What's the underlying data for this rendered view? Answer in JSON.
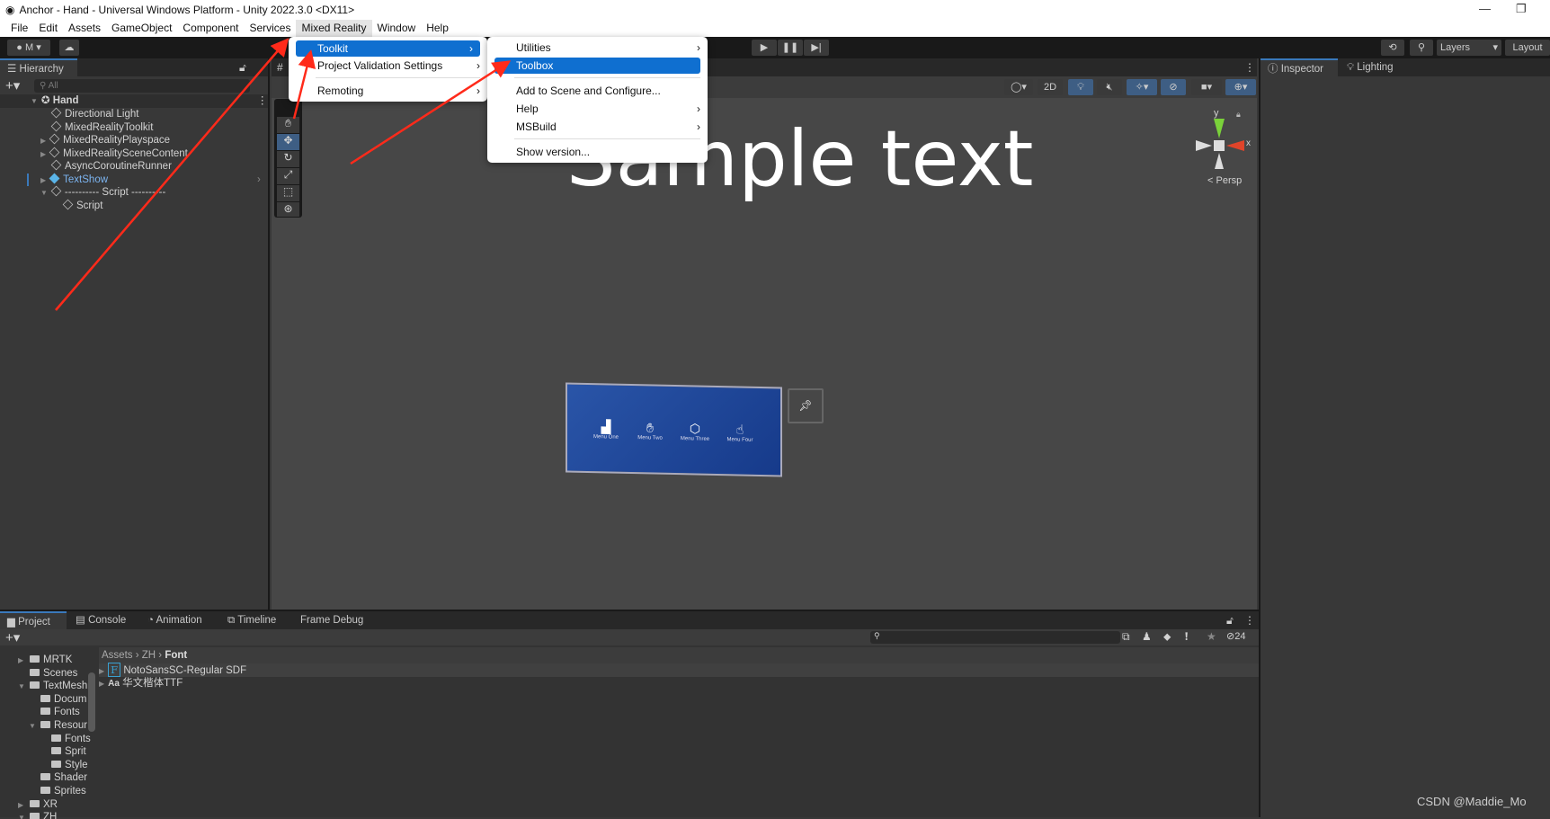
{
  "window": {
    "title": "Anchor - Hand - Universal Windows Platform - Unity 2022.3.0 <DX11>",
    "minimize_icon": "minimize-icon",
    "maximize_icon": "maximize-icon"
  },
  "menubar": [
    "File",
    "Edit",
    "Assets",
    "GameObject",
    "Component",
    "Services",
    "Mixed Reality",
    "Window",
    "Help"
  ],
  "toolbar": {
    "account": "M",
    "layers": "Layers",
    "layout": "Layout"
  },
  "mixed_reality_menu": {
    "items": [
      {
        "label": "Toolkit",
        "selected": true,
        "submenu": true
      },
      {
        "label": "Project Validation Settings",
        "submenu": true
      },
      {
        "label": "Remoting",
        "submenu": true
      }
    ]
  },
  "toolkit_submenu": {
    "items": [
      {
        "label": "Utilities",
        "submenu": true
      },
      {
        "label": "Toolbox",
        "selected": true
      },
      {
        "label": "Add to Scene and Configure..."
      },
      {
        "label": "Help",
        "submenu": true
      },
      {
        "label": "MSBuild",
        "submenu": true
      },
      {
        "label": "Show version..."
      }
    ]
  },
  "hierarchy": {
    "tab": "Hierarchy",
    "search_placeholder": "All",
    "root": "Hand",
    "items": [
      "Directional Light",
      "MixedRealityToolkit",
      "MixedRealityPlayspace",
      "MixedRealitySceneContent",
      "AsyncCoroutineRunner",
      "TextShow",
      "---------- Script ----------",
      "Script"
    ]
  },
  "scene": {
    "sample_text": "Sample text",
    "view_2d": "2D",
    "persp": "Persp",
    "axis_y": "y",
    "axis_x": "x",
    "hand_menu": [
      "Menu One",
      "Menu Two",
      "Menu Three",
      "Menu Four"
    ]
  },
  "inspector": {
    "tabs": [
      "Inspector",
      "Lighting"
    ]
  },
  "bottom": {
    "tabs": [
      "Project",
      "Console",
      "Animation",
      "Timeline",
      "Frame Debug"
    ],
    "hidden_count": "24",
    "breadcrumb": [
      "Assets",
      "ZH",
      "Font"
    ],
    "tree": [
      {
        "label": "MRTK",
        "depth": 0,
        "arrow": "right"
      },
      {
        "label": "Scenes",
        "depth": 0
      },
      {
        "label": "TextMesh",
        "depth": 0,
        "arrow": "down"
      },
      {
        "label": "Docum",
        "depth": 1
      },
      {
        "label": "Fonts",
        "depth": 1
      },
      {
        "label": "Resour",
        "depth": 1,
        "arrow": "down"
      },
      {
        "label": "Fonts",
        "depth": 2
      },
      {
        "label": "Sprit",
        "depth": 2
      },
      {
        "label": "Style",
        "depth": 2
      },
      {
        "label": "Shader",
        "depth": 1
      },
      {
        "label": "Sprites",
        "depth": 1
      },
      {
        "label": "XR",
        "depth": 0,
        "arrow": "right"
      },
      {
        "label": "ZH",
        "depth": 0,
        "arrow": "down"
      }
    ],
    "assets": [
      {
        "icon": "F",
        "label": "NotoSansSC-Regular SDF"
      },
      {
        "icon": "Aa",
        "label": "华文楷体TTF"
      }
    ]
  },
  "watermark": "CSDN @Maddie_Mo",
  "colors": {
    "accent": "#0f6fd0",
    "annotation_arrow": "#ff2a1a",
    "selection_text": "#7cb4f0"
  }
}
